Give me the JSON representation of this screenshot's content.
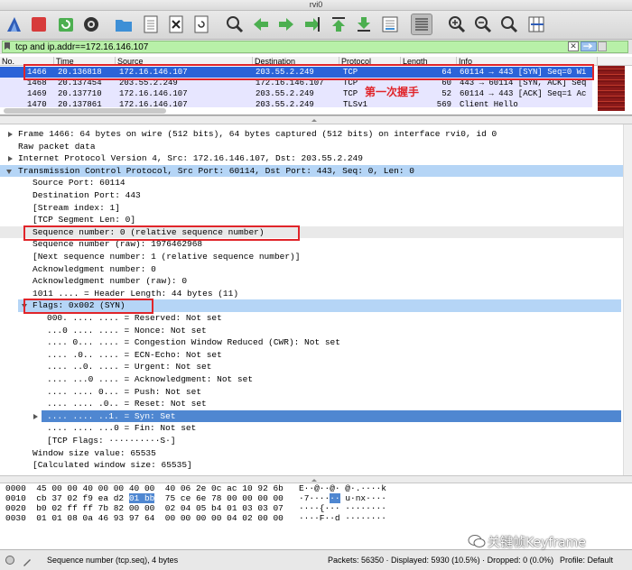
{
  "window": {
    "title": "rvi0"
  },
  "toolbar": {
    "buttons": [
      "shark-fin-icon",
      "stop-icon",
      "restart-icon",
      "gear-icon",
      "folder-icon",
      "file-icon",
      "close-file-icon",
      "reload-icon",
      "find-icon",
      "back-icon",
      "forward-icon",
      "goto-icon",
      "first-icon",
      "last-icon",
      "autoscroll-icon",
      "colorize-icon",
      "zoom-in-icon",
      "zoom-out-icon",
      "zoom-normal-icon",
      "resize-columns-icon"
    ]
  },
  "filter": {
    "value": "tcp and ip.addr==172.16.146.107",
    "clear": "✕",
    "apply": "→"
  },
  "packet_list": {
    "headers": {
      "no": "No.",
      "time": "Time",
      "source": "Source",
      "destination": "Destination",
      "protocol": "Protocol",
      "length": "Length",
      "info": "Info"
    },
    "rows": [
      {
        "no": "1466",
        "time": "20.136818",
        "source": "172.16.146.107",
        "destination": "203.55.2.249",
        "protocol": "TCP",
        "length": "64",
        "info": "60114 → 443 [SYN] Seq=0 Wi"
      },
      {
        "no": "1468",
        "time": "20.137454",
        "source": "203.55.2.249",
        "destination": "172.16.146.107",
        "protocol": "TCP",
        "length": "60",
        "info": "443 → 60114 [SYN, ACK] Seq"
      },
      {
        "no": "1469",
        "time": "20.137710",
        "source": "172.16.146.107",
        "destination": "203.55.2.249",
        "protocol": "TCP",
        "length": "52",
        "info": "60114 → 443 [ACK] Seq=1 Ac"
      },
      {
        "no": "1470",
        "time": "20.137861",
        "source": "172.16.146.107",
        "destination": "203.55.2.249",
        "protocol": "TLSv1",
        "length": "569",
        "info": "Client Hello"
      }
    ]
  },
  "annotation": {
    "first_handshake": "第一次握手"
  },
  "details": {
    "lines": [
      "Frame 1466: 64 bytes on wire (512 bits), 64 bytes captured (512 bits) on interface rvi0, id 0",
      "Raw packet data",
      "Internet Protocol Version 4, Src: 172.16.146.107, Dst: 203.55.2.249",
      "Transmission Control Protocol, Src Port: 60114, Dst Port: 443, Seq: 0, Len: 0",
      "Source Port: 60114",
      "Destination Port: 443",
      "[Stream index: 1]",
      "[TCP Segment Len: 0]",
      "Sequence number: 0    (relative sequence number)",
      "Sequence number (raw): 1976462968",
      "[Next sequence number: 1    (relative sequence number)]",
      "Acknowledgment number: 0",
      "Acknowledgment number (raw): 0",
      "1011 .... = Header Length: 44 bytes (11)",
      "Flags: 0x002 (SYN)",
      "000. .... .... = Reserved: Not set",
      "...0 .... .... = Nonce: Not set",
      ".... 0... .... = Congestion Window Reduced (CWR): Not set",
      ".... .0.. .... = ECN-Echo: Not set",
      ".... ..0. .... = Urgent: Not set",
      ".... ...0 .... = Acknowledgment: Not set",
      ".... .... 0... = Push: Not set",
      ".... .... .0.. = Reset: Not set",
      ".... .... ..1. = Syn: Set",
      ".... .... ...0 = Fin: Not set",
      "[TCP Flags: ··········S·]",
      "Window size value: 65535",
      "[Calculated window size: 65535]"
    ]
  },
  "bytes": {
    "rows": [
      {
        "offset": "0000",
        "hex_a": "45 00 00 40 00 00 40 00",
        "hex_b": "40 06 2e 0c ac 10 92 6b",
        "ascii_a": "E··@··@·",
        "ascii_b": "@·.····k"
      },
      {
        "offset": "0010",
        "hex_a": "cb 37 02 f9 ea d2 ",
        "hex_sel": "01 bb",
        "hex_b": "75 ce 6e 78 00 00 00 00",
        "ascii_a": "·7····",
        "ascii_sel": "··",
        "ascii_b": "u·nx····"
      },
      {
        "offset": "0020",
        "hex_a": "b0 02 ff ff 7b 82 00 00",
        "hex_b": "02 04 05 b4 01 03 03 07",
        "ascii_a": "····{···",
        "ascii_b": "········"
      },
      {
        "offset": "0030",
        "hex_a": "01 01 08 0a 46 93 97 64",
        "hex_b": "00 00 00 00 04 02 00 00",
        "ascii_a": "····F··d",
        "ascii_b": "········"
      }
    ]
  },
  "status": {
    "field": "Sequence number (tcp.seq), 4 bytes",
    "counts": "Packets: 56350 · Displayed: 5930 (10.5%) · Dropped: 0 (0.0%)",
    "profile": "Profile: Default"
  },
  "watermark": {
    "text": "关键帧Keyframe"
  },
  "colors": {
    "selected_row": "#2b63d8",
    "filter_ok": "#b8f0a8",
    "tree_selection": "#b5d5f6",
    "annotation": "#e0252a",
    "tcp_row": "#e7e6ff"
  }
}
